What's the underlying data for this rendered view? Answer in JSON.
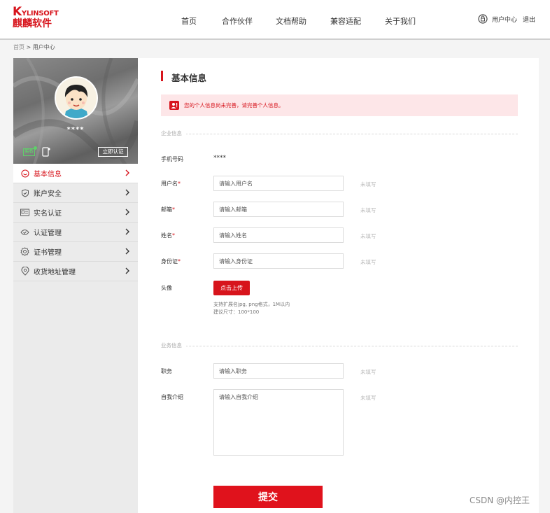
{
  "header": {
    "logo_en_initial": "K",
    "logo_en_rest": "YLINSOFT",
    "logo_cn": "麒麟软件",
    "nav": [
      "首页",
      "合作伙伴",
      "文档帮助",
      "兼容适配",
      "关于我们"
    ],
    "user_center": "用户中心",
    "logout": "退出"
  },
  "breadcrumb": {
    "home": "首页",
    "separator": ">",
    "current": "用户中心"
  },
  "sidebar": {
    "username": "****",
    "id_badge_text": "实名",
    "verify_button": "立即认证",
    "items": [
      {
        "label": "基本信息",
        "icon": "smile-circle-icon",
        "active": true
      },
      {
        "label": "账户安全",
        "icon": "shield-check-icon",
        "active": false
      },
      {
        "label": "实名认证",
        "icon": "id-card-icon",
        "active": false
      },
      {
        "label": "认证管理",
        "icon": "certification-icon",
        "active": false
      },
      {
        "label": "证书管理",
        "icon": "gear-icon",
        "active": false
      },
      {
        "label": "收货地址管理",
        "icon": "location-pin-icon",
        "active": false
      }
    ]
  },
  "main": {
    "title": "基本信息",
    "alert": "您的个人信息尚未完善，请完善个人信息。",
    "section_company": "企业信息",
    "section_business": "业务信息",
    "fields": {
      "phone": {
        "label": "手机号码",
        "value": "****"
      },
      "username": {
        "label": "用户名",
        "required": "*",
        "placeholder": "请输入用户名",
        "hint": "未填写"
      },
      "email": {
        "label": "邮箱",
        "required": "*",
        "placeholder": "请输入邮箱",
        "hint": "未填写"
      },
      "name": {
        "label": "姓名",
        "required": "*",
        "placeholder": "请输入姓名",
        "hint": "未填写"
      },
      "idcard": {
        "label": "身份证",
        "required": "*",
        "placeholder": "请输入身份证",
        "hint": "未填写"
      },
      "avatar": {
        "label": "头像",
        "button": "点击上传",
        "note1": "支持扩展名jpg, png格式，1M以内",
        "note2": "建议尺寸：100*100"
      },
      "job": {
        "label": "职务",
        "placeholder": "请输入职务",
        "hint": "未填写"
      },
      "intro": {
        "label": "自我介绍",
        "placeholder": "请输入自我介绍",
        "hint": "未填写"
      }
    },
    "submit": "提交"
  },
  "watermark": "CSDN @内控王",
  "colors": {
    "accent": "#d7141c",
    "alert_bg": "#fde6e8",
    "page_bg": "#f4f4f4",
    "sidebar_bg": "#ebebeb"
  }
}
